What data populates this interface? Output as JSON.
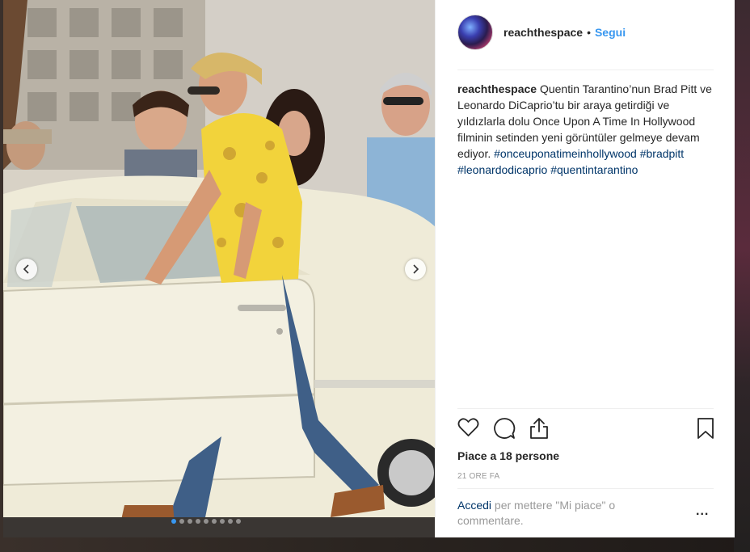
{
  "post": {
    "username": "reachthespace",
    "separator": "•",
    "follow_label": "Segui",
    "caption_user": "reachthespace",
    "caption_text": " Quentin Tarantino’nun Brad Pitt ve Leonardo DiCaprio’tu bir araya getirdiği ve yıldızlarla dolu Once Upon A Time In Hollywood filminin setinden yeni görüntüler gelmeye devam ediyor. ",
    "hashtags": [
      "#onceuponatimeinhollywood",
      "#bradpitt",
      "#leonardodicaprio",
      "#quentintarantino"
    ],
    "likes_text": "Piace a 18 persone",
    "timestamp": "21 ORE FA",
    "login_link": "Accedi",
    "login_rest": " per mettere \"Mi piace\" o commentare.",
    "more_label": "..."
  },
  "carousel": {
    "slide_count": 9,
    "active_index": 0
  },
  "icons": {
    "like": "heart-icon",
    "comment": "comment-icon",
    "share": "share-icon",
    "save": "bookmark-icon",
    "prev": "chevron-left-icon",
    "next": "chevron-right-icon"
  },
  "colors": {
    "accent": "#3897f0",
    "hashtag": "#003569",
    "muted": "#999999",
    "text": "#262626"
  }
}
